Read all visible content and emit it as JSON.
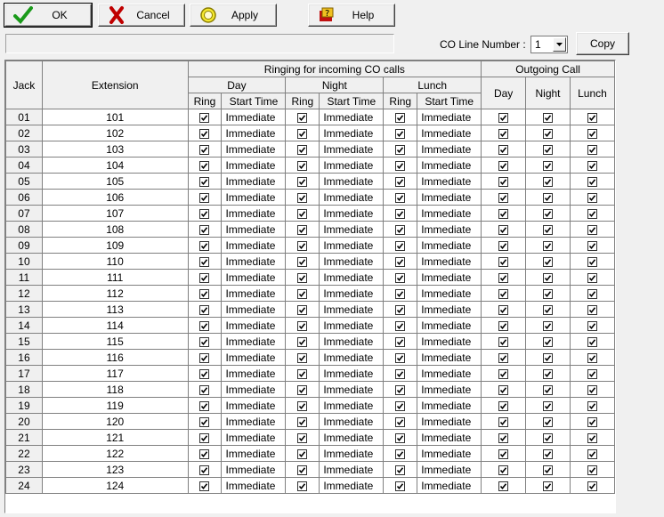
{
  "toolbar": {
    "ok_label": "OK",
    "cancel_label": "Cancel",
    "apply_label": "Apply",
    "help_label": "Help"
  },
  "co_line": {
    "label": "CO Line Number :",
    "value": "1",
    "copy_label": "Copy"
  },
  "table": {
    "col_jack": "Jack",
    "col_extension": "Extension",
    "group_ringing": "Ringing for incoming CO calls",
    "group_outgoing": "Outgoing Call",
    "periods": [
      "Day",
      "Night",
      "Lunch"
    ],
    "sub_ring": "Ring",
    "sub_start": "Start Time",
    "rows": [
      {
        "jack": "01",
        "ext": "101"
      },
      {
        "jack": "02",
        "ext": "102"
      },
      {
        "jack": "03",
        "ext": "103"
      },
      {
        "jack": "04",
        "ext": "104"
      },
      {
        "jack": "05",
        "ext": "105"
      },
      {
        "jack": "06",
        "ext": "106"
      },
      {
        "jack": "07",
        "ext": "107"
      },
      {
        "jack": "08",
        "ext": "108"
      },
      {
        "jack": "09",
        "ext": "109"
      },
      {
        "jack": "10",
        "ext": "110"
      },
      {
        "jack": "11",
        "ext": "111"
      },
      {
        "jack": "12",
        "ext": "112"
      },
      {
        "jack": "13",
        "ext": "113"
      },
      {
        "jack": "14",
        "ext": "114"
      },
      {
        "jack": "15",
        "ext": "115"
      },
      {
        "jack": "16",
        "ext": "116"
      },
      {
        "jack": "17",
        "ext": "117"
      },
      {
        "jack": "18",
        "ext": "118"
      },
      {
        "jack": "19",
        "ext": "119"
      },
      {
        "jack": "20",
        "ext": "120"
      },
      {
        "jack": "21",
        "ext": "121"
      },
      {
        "jack": "22",
        "ext": "122"
      },
      {
        "jack": "23",
        "ext": "123"
      },
      {
        "jack": "24",
        "ext": "124"
      }
    ],
    "start_time_value": "Immediate",
    "ring_checked": true,
    "outgoing_checked": true
  }
}
